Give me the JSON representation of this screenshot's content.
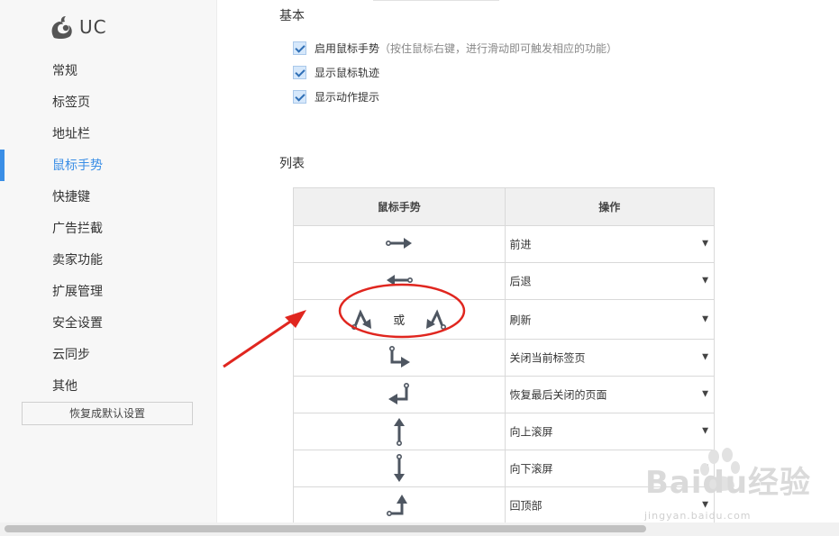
{
  "app": {
    "logo_text": "UC"
  },
  "sidebar": {
    "items": [
      {
        "label": "常规",
        "active": false
      },
      {
        "label": "标签页",
        "active": false
      },
      {
        "label": "地址栏",
        "active": false
      },
      {
        "label": "鼠标手势",
        "active": true
      },
      {
        "label": "快捷键",
        "active": false
      },
      {
        "label": "广告拦截",
        "active": false
      },
      {
        "label": "卖家功能",
        "active": false
      },
      {
        "label": "扩展管理",
        "active": false
      },
      {
        "label": "安全设置",
        "active": false
      },
      {
        "label": "云同步",
        "active": false
      },
      {
        "label": "其他",
        "active": false
      }
    ],
    "reset_label": "恢复成默认设置"
  },
  "basic": {
    "title": "基本",
    "options": [
      {
        "label": "启用鼠标手势",
        "hint": "（按住鼠标右键，进行滑动即可触发相应的功能）",
        "checked": true
      },
      {
        "label": "显示鼠标轨迹",
        "hint": "",
        "checked": true
      },
      {
        "label": "显示动作提示",
        "hint": "",
        "checked": true
      }
    ]
  },
  "list": {
    "title": "列表",
    "header_gesture": "鼠标手势",
    "header_action": "操作",
    "or_label": "或",
    "rows": [
      {
        "gesture_icon": "arrow-right-icon",
        "action": "前进"
      },
      {
        "gesture_icon": "arrow-left-icon",
        "action": "后退"
      },
      {
        "gesture_icon": "up-down-refresh-icon",
        "action": "刷新"
      },
      {
        "gesture_icon": "down-right-icon",
        "action": "关闭当前标签页"
      },
      {
        "gesture_icon": "down-left-icon",
        "action": "恢复最后关闭的页面"
      },
      {
        "gesture_icon": "arrow-up-icon",
        "action": "向上滚屏"
      },
      {
        "gesture_icon": "arrow-down-icon",
        "action": "向下滚屏"
      },
      {
        "gesture_icon": "right-up-icon",
        "action": "回顶部"
      }
    ]
  },
  "watermark": {
    "brand": "Baidu经验",
    "url": "jingyan.baidu.com"
  },
  "colors": {
    "accent": "#3a8ee6",
    "annotation": "#e0261f",
    "gesture": "#4e5661"
  }
}
